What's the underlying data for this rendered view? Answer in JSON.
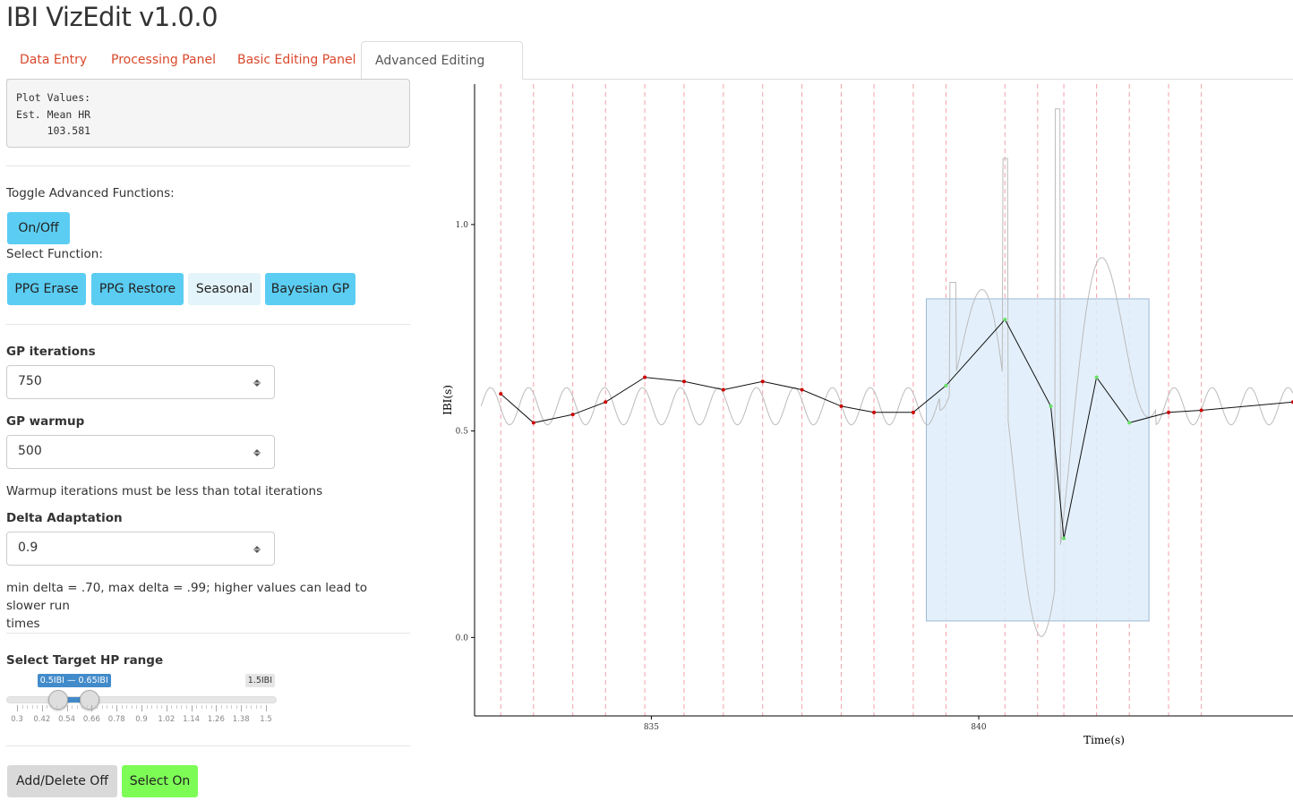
{
  "app": {
    "title": "IBI VizEdit v1.0.0"
  },
  "tabs": [
    {
      "label": "Data Entry",
      "active": false
    },
    {
      "label": "Processing Panel",
      "active": false
    },
    {
      "label": "Basic Editing Panel",
      "active": false
    },
    {
      "label": "Advanced Editing Panel",
      "active": true
    }
  ],
  "plot_values": {
    "line1": "Plot Values:",
    "line2": "Est. Mean HR",
    "line3": "     103.581"
  },
  "advanced": {
    "toggle_label": "Toggle Advanced Functions:",
    "toggle_button": "On/Off",
    "select_label": "Select Function:",
    "functions": [
      "PPG Erase",
      "PPG Restore",
      "Seasonal",
      "Bayesian GP"
    ]
  },
  "gp": {
    "iterations_label": "GP iterations",
    "iterations_value": "750",
    "warmup_label": "GP warmup",
    "warmup_value": "500",
    "warmup_help": "Warmup iterations must be less than total iterations",
    "delta_label": "Delta Adaptation",
    "delta_value": "0.9",
    "delta_help_line1": "min delta = .70, max delta = .99; higher values can lead to slower run",
    "delta_help_line2": "times"
  },
  "hp_range": {
    "label": "Select Target HP range",
    "from_to_badge": "0.5IBI — 0.65IBI",
    "max_badge": "1.5IBI",
    "min": 0.3,
    "max": 1.5,
    "from": 0.5,
    "to": 0.65,
    "tick_labels": [
      "0.3",
      "0.42",
      "0.54",
      "0.66",
      "0.78",
      "0.9",
      "1.02",
      "1.14",
      "1.26",
      "1.38",
      "1.5"
    ]
  },
  "bottom_buttons": {
    "add_delete": "Add/Delete Off",
    "select": "Select On"
  },
  "colors": {
    "tab_link": "#d9482b",
    "button_blue": "#5bcdf2",
    "button_pale": "#e3f4fb",
    "button_gray": "#d9d9d9",
    "button_green": "#7dfc56",
    "selection_fill": "#deedfa",
    "ibi_red": "#cc0000",
    "ibi_green": "#66e066",
    "ppg_line": "#bbbbbb",
    "beat_marker": "#f4a0aa"
  },
  "chart_data": {
    "type": "line",
    "xlabel": "Time(s)",
    "ylabel": "IBI(s)",
    "xlim": [
      832.3,
      844.8
    ],
    "ylim": [
      -0.19,
      1.34
    ],
    "x_ticks": [
      835,
      840
    ],
    "y_ticks": [
      0.0,
      0.5,
      1.0
    ],
    "grid": false,
    "series": [
      {
        "values_t": [
          832.7,
          833.2,
          833.8,
          834.3,
          834.9,
          835.5,
          836.1,
          836.7,
          837.3,
          837.9,
          838.4,
          839.0,
          839.5,
          840.4,
          841.1,
          841.3,
          841.8,
          842.3,
          842.9,
          843.4,
          844.8
        ],
        "values_ibi": [
          0.59,
          0.52,
          0.54,
          0.57,
          0.63,
          0.62,
          0.6,
          0.62,
          0.6,
          0.56,
          0.545,
          0.545,
          0.61,
          0.77,
          0.56,
          0.24,
          0.63,
          0.52,
          0.545,
          0.55,
          0.57
        ],
        "point_status": [
          "red",
          "red",
          "red",
          "red",
          "red",
          "red",
          "red",
          "red",
          "red",
          "red",
          "red",
          "red",
          "green",
          "green",
          "green",
          "green",
          "green",
          "green",
          "red",
          "red",
          "red"
        ]
      }
    ],
    "beat_times": [
      832.7,
      833.2,
      833.8,
      834.3,
      834.9,
      835.5,
      836.1,
      836.7,
      837.3,
      837.9,
      838.4,
      839.0,
      839.5,
      840.4,
      840.9,
      841.3,
      841.8,
      842.3,
      842.9,
      843.4
    ],
    "selection": {
      "x": [
        839.2,
        842.6
      ],
      "y": [
        0.04,
        0.82
      ]
    }
  }
}
